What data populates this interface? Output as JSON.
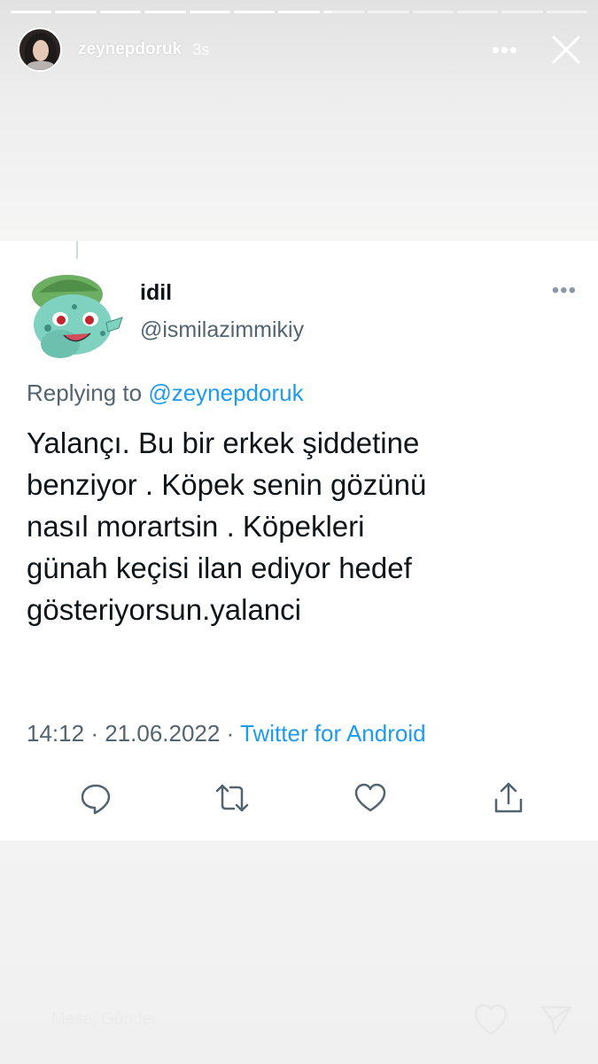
{
  "story": {
    "username": "zeynepdoruk",
    "time": "3s",
    "progress": {
      "segments_total": 13,
      "segments_complete": 7,
      "current_segment_fraction": 0.2
    },
    "more_icon": "more-horizontal-icon",
    "close_icon": "close-icon"
  },
  "tweet": {
    "display_name": "idil",
    "handle": "@ismilazimmikiy",
    "replying_prefix": "Replying to",
    "replying_to": "@zeynepdoruk",
    "text_lines": [
      "Yalançı. Bu bir erkek şiddetine",
      "benziyor . Köpek senin gözünü",
      "nasıl morartsin . Köpekleri",
      "günah keçisi ilan ediyor hedef",
      "gösteriyorsun.yalanci"
    ],
    "time": "14:12",
    "date": "21.06.2022",
    "separator": "·",
    "source": "Twitter for Android",
    "actions": [
      "reply-icon",
      "retweet-icon",
      "like-icon",
      "share-icon"
    ],
    "colors": {
      "link": "#1d9bf0",
      "secondary": "#536471",
      "text": "#0f1419"
    }
  },
  "footer": {
    "message_placeholder": "Mesaj Gönder",
    "heart_icon": "heart-icon",
    "send_icon": "send-icon"
  }
}
